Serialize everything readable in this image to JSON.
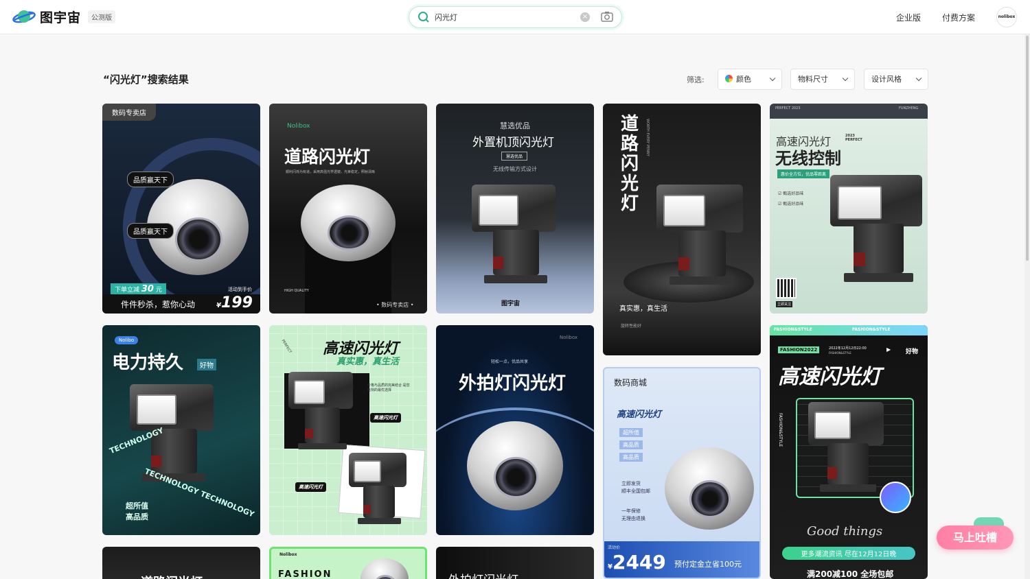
{
  "header": {
    "logo_text": "图宇宙",
    "beta_badge": "公测版",
    "search_value": "闪光灯",
    "nav_enterprise": "企业版",
    "nav_pricing": "付费方案",
    "avatar_text": "nolibox"
  },
  "results": {
    "title": "“闪光灯”搜索结果",
    "filter_label": "筛选:",
    "filters": [
      "颜色",
      "物料尺寸",
      "设计风格"
    ]
  },
  "cards": {
    "c1": {
      "tag": "数码专卖店",
      "badge1": "品质赢天下",
      "badge2": "品质赢天下",
      "promo": "下单立减",
      "promo_num": "30",
      "promo_unit": "元",
      "slogan": "件件秒杀，惹你心动",
      "price_note": "活动到手价",
      "currency": "¥",
      "price": "199"
    },
    "c2": {
      "brand": "Nolibox",
      "title": "道路闪光灯",
      "sub": "顺利闪烁为有道，采用高强光学透镜，光束稳定，照射清晰",
      "corner": "HIGH QUALITY",
      "shop": "• 数码专卖店 •"
    },
    "c3": {
      "small": "慧选优品",
      "title": "外置机顶闪光灯",
      "badge": "慧选优品",
      "sub": "无线传输方式设计",
      "logo": "图宇宙"
    },
    "c4": {
      "title": "道路闪光灯",
      "side": "WORTH EVERY PENNY",
      "slogan": "真实惠，真生活",
      "sub": "旋转性能好"
    },
    "c5": {
      "corner_l": "PERFECT 2023",
      "corner_r": "FUNZHENG",
      "title1": "高速闪光灯",
      "tag": "2023 PERFECT",
      "title2": "无线控制",
      "badge": "惠价全方位，优品零距离",
      "check1": "甄选好品味",
      "check2": "甄选好品味",
      "qr": "立即关注"
    },
    "c6": {
      "brand": "Nolibo",
      "title": "电力持久",
      "tag": "好物",
      "tech1": "TECHNOLOGY",
      "tech2": "TECHNOLOGY TECHNOLOGY",
      "line1": "超所值",
      "line2": "高品质"
    },
    "c7": {
      "title": "高速闪光灯",
      "sub": "真实惠，真生活",
      "desc": "价格与品质的完美结合 是您此刻的最优选择",
      "badge1": "高速闪光灯",
      "badge2": "高速闪光灯",
      "corner": "PERFECT"
    },
    "c8": {
      "brand": "Nolibox",
      "small": "轻松一点，优品共享",
      "title": "外拍灯闪光灯"
    },
    "c9": {
      "shop": "数码商城",
      "title": "高速闪光灯",
      "tag1": "超所值",
      "tag2": "高品质",
      "tag3": "高品质",
      "ship1": "立即发货",
      "ship2": "顺丰全国包邮",
      "warranty1": "一年保修",
      "warranty2": "无理由退换",
      "price_note": "活动价",
      "currency": "¥",
      "price": "2449",
      "deposit": "预付定金立省100元"
    },
    "c10": {
      "top_l": "FASHION&STYLE",
      "top_r": "FASHION&STYLE",
      "badge": "FASHION2022",
      "date": "2022年12月12日22:00",
      "date_sub": "FASHION&STYLE",
      "good": "好物",
      "title": "高速闪光灯",
      "side": "FASHION&STYLE",
      "script": "Good  things",
      "bar": "更多潮流资讯 尽在12月12日晚",
      "footer": "满200减100 全场包邮"
    },
    "c11": {
      "title": "道路闪光灯"
    },
    "c12": {
      "brand": "Nolibox",
      "title": "FASHION"
    },
    "c13": {
      "title": "外拍灯闪光灯"
    }
  },
  "help_button": "马上吐槽"
}
